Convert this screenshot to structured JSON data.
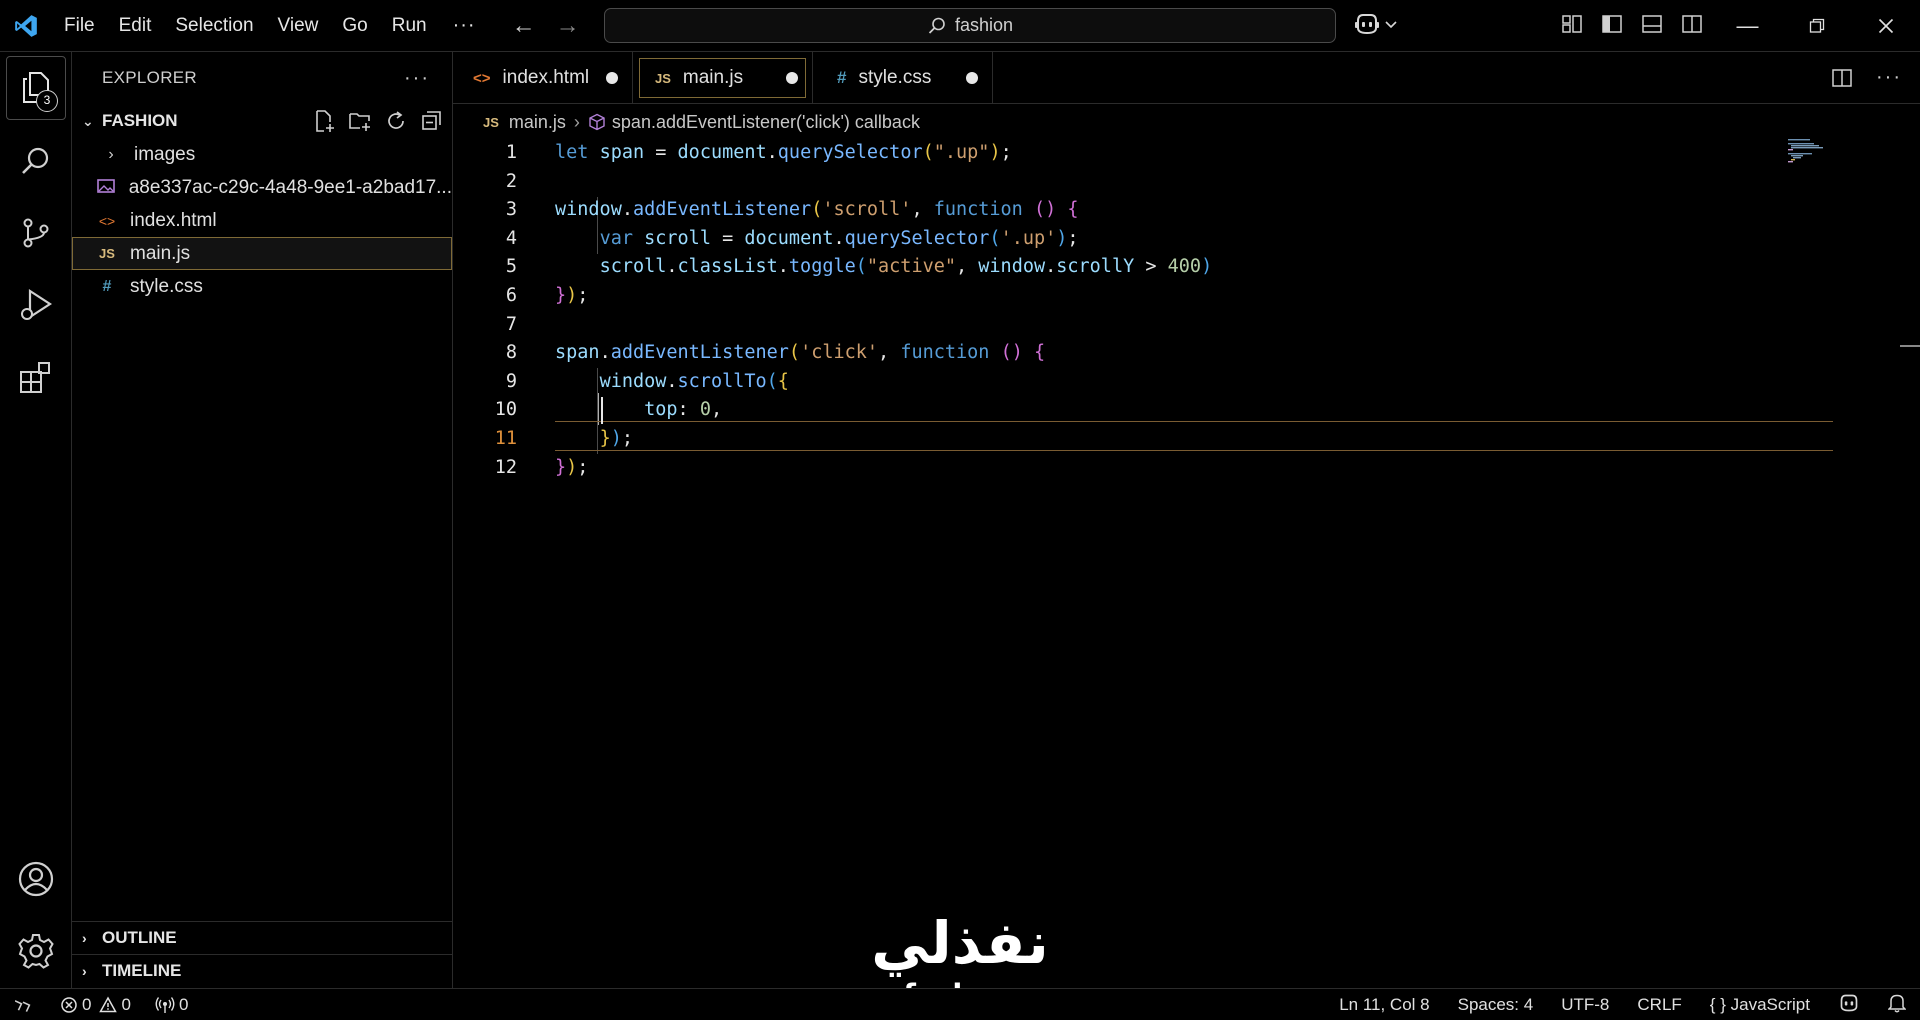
{
  "titlebar": {
    "menu": [
      "File",
      "Edit",
      "Selection",
      "View",
      "Go",
      "Run"
    ],
    "more": "···",
    "search": "fashion"
  },
  "activitybar": {
    "explorer_badge": "3",
    "items": [
      "explorer-icon",
      "search-icon",
      "source-control-icon",
      "run-debug-icon",
      "extensions-icon"
    ],
    "bottom": [
      "account-icon",
      "settings-gear-icon"
    ]
  },
  "sidebar": {
    "title": "EXPLORER",
    "more": "···",
    "folder": "FASHION",
    "items": [
      {
        "label": "images",
        "type": "folder"
      },
      {
        "label": "a8e337ac-c29c-4a48-9ee1-a2bad17...",
        "type": "image"
      },
      {
        "label": "index.html",
        "type": "html"
      },
      {
        "label": "main.js",
        "type": "js"
      },
      {
        "label": "style.css",
        "type": "css"
      }
    ],
    "outline": "OUTLINE",
    "timeline": "TIMELINE"
  },
  "tabs": [
    {
      "label": "index.html",
      "icon": "<>",
      "modified": true
    },
    {
      "label": "main.js",
      "icon": "JS",
      "modified": true,
      "active": true
    },
    {
      "label": "style.css",
      "icon": "#",
      "modified": true
    }
  ],
  "breadcrumb": {
    "file_icon": "JS",
    "file": "main.js",
    "symbol": "span.addEventListener('click') callback"
  },
  "editor": {
    "line_numbers": [
      "1",
      "2",
      "3",
      "4",
      "5",
      "6",
      "7",
      "8",
      "9",
      "10",
      "11",
      "12"
    ],
    "current_line": 11
  },
  "watermark": {
    "arabic": "نفذلي",
    "latin": "nafezly.com"
  },
  "statusbar": {
    "errors": "0",
    "warnings": "0",
    "ports": "0",
    "position": "Ln 11, Col 8",
    "spaces": "Spaces: 4",
    "encoding": "UTF-8",
    "eol": "CRLF",
    "language_brace": "{ }",
    "language": "JavaScript"
  }
}
